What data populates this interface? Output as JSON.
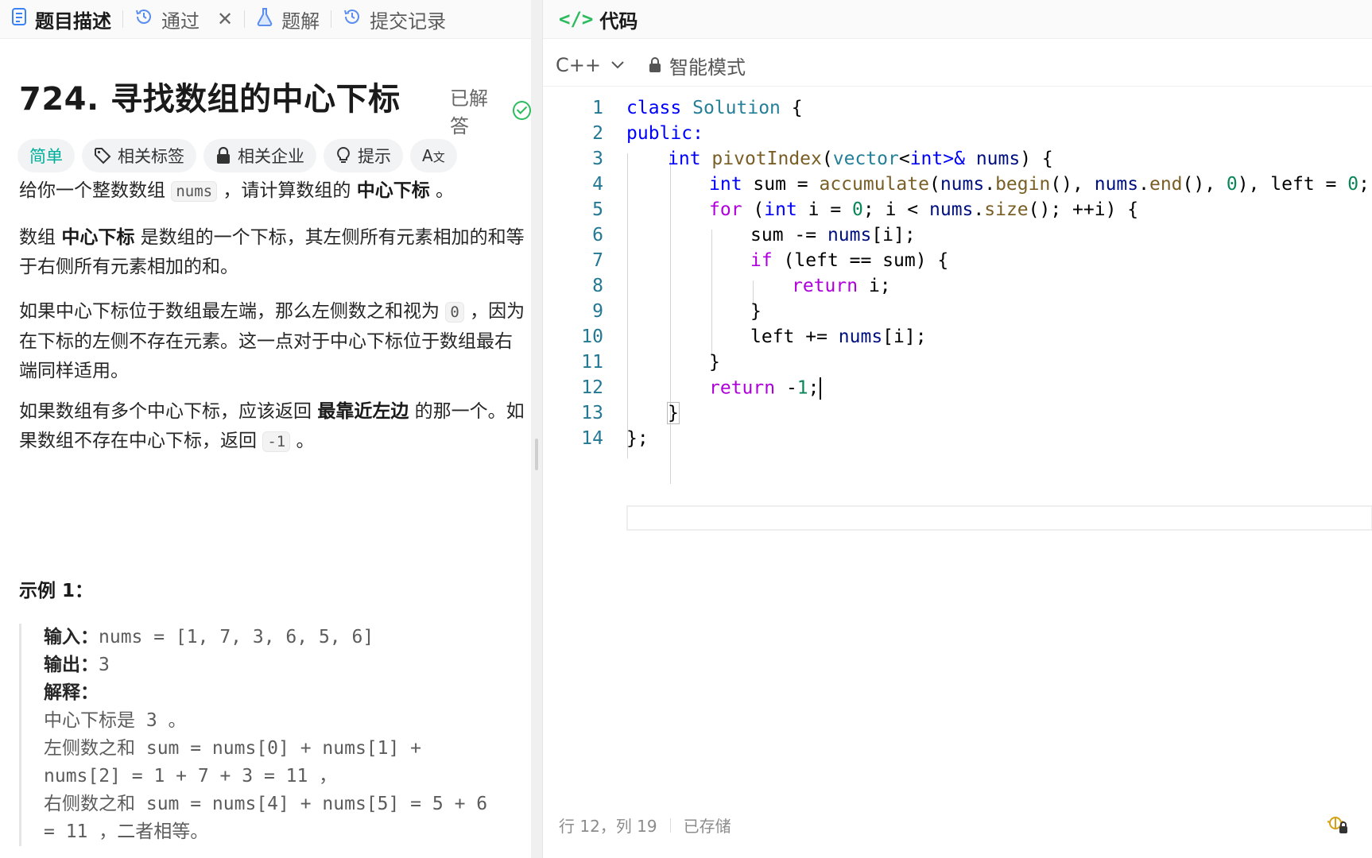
{
  "left_tabs": {
    "description": "题目描述",
    "passed": "通过",
    "solutions": "题解",
    "submissions": "提交记录"
  },
  "problem": {
    "title": "724. 寻找数组的中心下标",
    "status": "已解答",
    "chips": {
      "difficulty": "简单",
      "tags": "相关标签",
      "companies": "相关企业",
      "hint": "提示"
    },
    "p1": {
      "a": "给你一个整数数组 ",
      "code": "nums",
      "b": " ，请计算数组的 ",
      "bold": "中心下标",
      "c": " 。"
    },
    "p2": {
      "a": "数组 ",
      "bold": "中心下标",
      "b": " 是数组的一个下标，其左侧所有元素相加的和等于右侧所有元素相加的和。"
    },
    "p3": {
      "a": "如果中心下标位于数组最左端，那么左侧数之和视为 ",
      "code": "0",
      "b": " ，因为在下标的左侧不存在元素。这一点对于中心下标位于数组最右端同样适用。"
    },
    "p4": {
      "a": "如果数组有多个中心下标，应该返回 ",
      "bold": "最靠近左边",
      "b": " 的那一个。如果数组不存在中心下标，返回 ",
      "code": "-1",
      "c": " 。"
    },
    "example": {
      "heading": "示例 1：",
      "input_label": "输入：",
      "input": "nums = [1, 7, 3, 6, 5, 6]",
      "output_label": "输出：",
      "output": "3",
      "explain_label": "解释：",
      "lines": [
        "中心下标是 3 。",
        "左侧数之和 sum = nums[0] + nums[1] +",
        "nums[2] = 1 + 7 + 3 = 11 ，",
        "右侧数之和 sum = nums[4] + nums[5] = 5 + 6",
        "= 11 ，二者相等。"
      ]
    }
  },
  "editor": {
    "header": "代码",
    "language": "C++",
    "mode": "智能模式",
    "line_numbers": [
      "1",
      "2",
      "3",
      "4",
      "5",
      "6",
      "7",
      "8",
      "9",
      "10",
      "11",
      "12",
      "13",
      "14"
    ],
    "code": {
      "l1": {
        "kw": "class",
        "ty": "Solution",
        "rest": " {"
      },
      "l2": {
        "kw": "public:"
      },
      "l3": {
        "kw": "int",
        "fn": "pivotIndex",
        "p1": "(",
        "ty": "vector",
        "lt": "<",
        "kw2": "int",
        "gt": ">&",
        "var": "nums",
        "p2": ") {"
      },
      "l4": {
        "kw": "int",
        "a": " sum = ",
        "fn": "accumulate",
        "b": "(",
        "v1": "nums",
        "c": ".",
        "f1": "begin",
        "d": "(), ",
        "v2": "nums",
        "e": ".",
        "f2": "end",
        "f": "(), ",
        "n": "0",
        "g": "), left = ",
        "n2": "0",
        "h": ";"
      },
      "l5": {
        "ctl": "for",
        "a": " (",
        "kw": "int",
        "b": " i = ",
        "n": "0",
        "c": "; i < ",
        "v": "nums",
        "d": ".",
        "f": "size",
        "e": "(); ++i) {"
      },
      "l6": {
        "a": "sum -= ",
        "v": "nums",
        "b": "[i];"
      },
      "l7": {
        "ctl": "if",
        "a": " (left == sum) {"
      },
      "l8": {
        "ctl": "return",
        "a": " i;"
      },
      "l9": {
        "a": "}"
      },
      "l10": {
        "a": "left += ",
        "v": "nums",
        "b": "[i];"
      },
      "l11": {
        "a": "}"
      },
      "l12": {
        "ctl": "return",
        "a": " -",
        "n": "1",
        "b": ";"
      },
      "l13": {
        "a": "}"
      },
      "l14": {
        "a": "};"
      }
    },
    "status": {
      "position": "行 12，列 19",
      "saved": "已存储"
    }
  },
  "colors": {
    "accent_green": "#2cbb5d",
    "easy_teal": "#00af9b",
    "keyword_blue": "#0000ff",
    "type_teal": "#267f99",
    "function_brown": "#795e26",
    "control_purple": "#af00db",
    "number_green": "#098658",
    "line_number": "#237893"
  }
}
